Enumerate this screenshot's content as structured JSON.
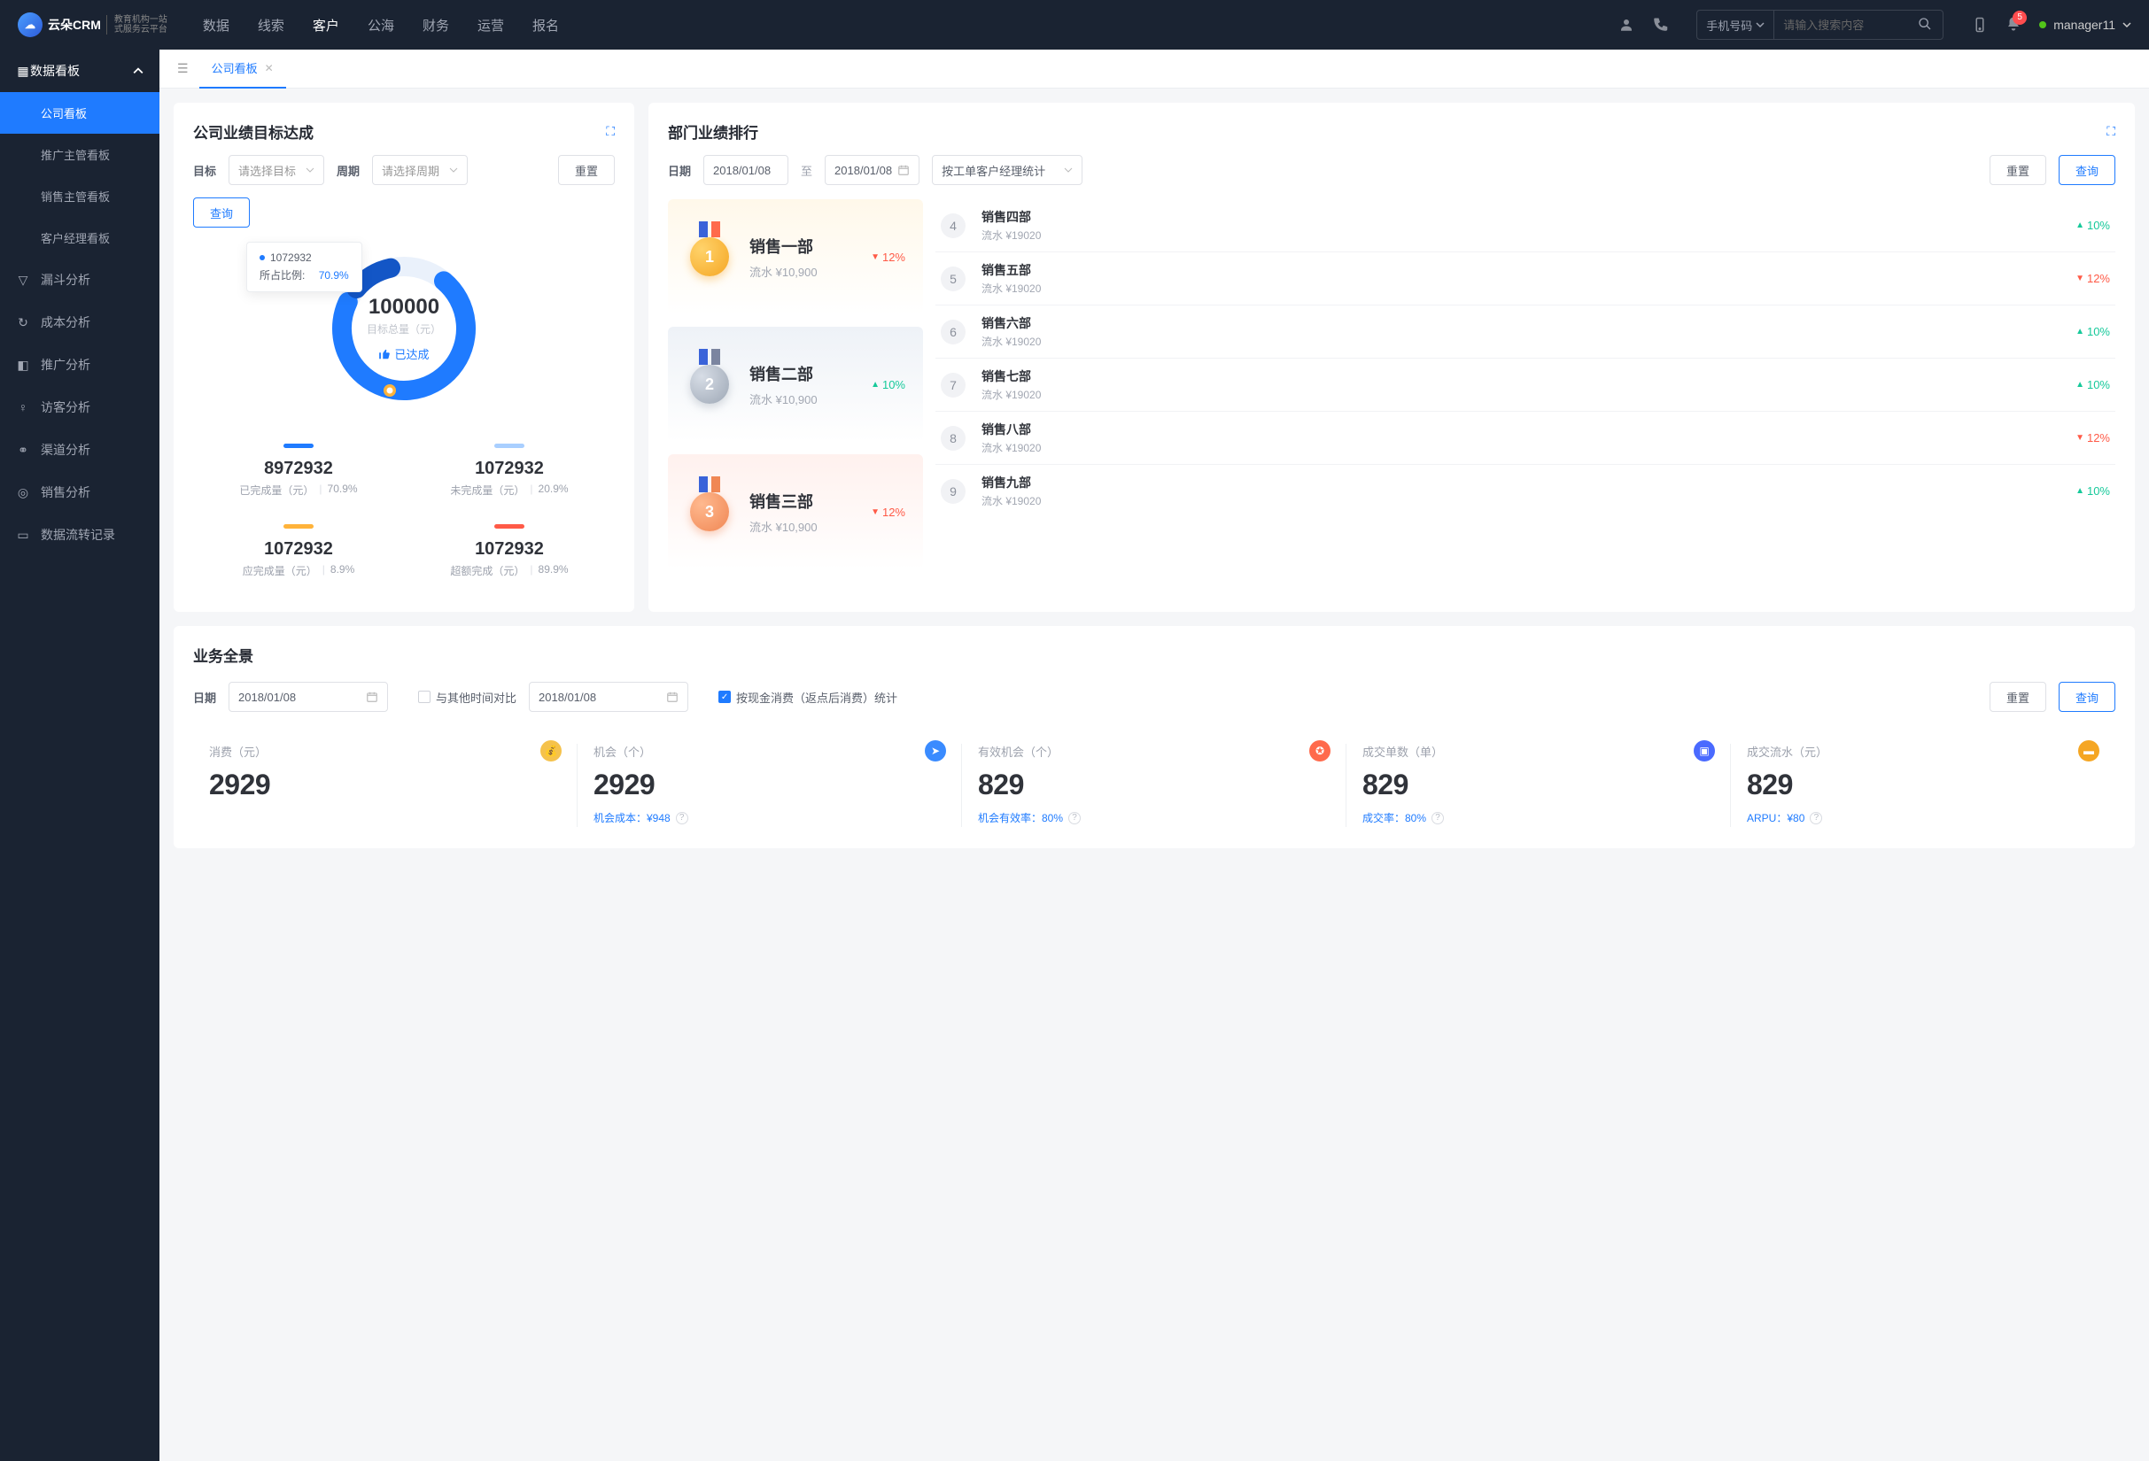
{
  "top": {
    "logo_text": "云朵CRM",
    "logo_sub": "教育机构一站\n式服务云平台",
    "nav": [
      "数据",
      "线索",
      "客户",
      "公海",
      "财务",
      "运营",
      "报名"
    ],
    "nav_active_index": 2,
    "search_type": "手机号码",
    "search_placeholder": "请输入搜索内容",
    "badge": "5",
    "user": "manager11"
  },
  "sidebar": {
    "group": "数据看板",
    "subs": [
      "公司看板",
      "推广主管看板",
      "销售主管看板",
      "客户经理看板"
    ],
    "sub_active": 0,
    "items": [
      "漏斗分析",
      "成本分析",
      "推广分析",
      "访客分析",
      "渠道分析",
      "销售分析",
      "数据流转记录"
    ]
  },
  "tabs": {
    "active": "公司看板"
  },
  "goal": {
    "title": "公司业绩目标达成",
    "label_target": "目标",
    "sel_target": "请选择目标",
    "label_period": "周期",
    "sel_period": "请选择周期",
    "btn_reset": "重置",
    "btn_query": "查询",
    "tooltip_value": "1072932",
    "tooltip_label": "所占比例:",
    "tooltip_pct": "70.9%",
    "center_value": "100000",
    "center_label": "目标总量（元）",
    "center_status": "已达成",
    "metrics": [
      {
        "bar": "m-blue",
        "v": "8972932",
        "l": "已完成量（元）",
        "p": "70.9%"
      },
      {
        "bar": "m-lblue",
        "v": "1072932",
        "l": "未完成量（元）",
        "p": "20.9%"
      },
      {
        "bar": "m-orange",
        "v": "1072932",
        "l": "应完成量（元）",
        "p": "8.9%"
      },
      {
        "bar": "m-red",
        "v": "1072932",
        "l": "超额完成（元）",
        "p": "89.9%"
      }
    ]
  },
  "rank": {
    "title": "部门业绩排行",
    "label_date": "日期",
    "date1": "2018/01/08",
    "date_sep": "至",
    "date2": "2018/01/08",
    "sel_stat": "按工单客户经理统计",
    "btn_reset": "重置",
    "btn_query": "查询",
    "podium": [
      {
        "rank": "1",
        "name": "销售一部",
        "sub": "流水 ¥10,900",
        "chg": "12%",
        "dir": "down"
      },
      {
        "rank": "2",
        "name": "销售二部",
        "sub": "流水 ¥10,900",
        "chg": "10%",
        "dir": "up"
      },
      {
        "rank": "3",
        "name": "销售三部",
        "sub": "流水 ¥10,900",
        "chg": "12%",
        "dir": "down"
      }
    ],
    "list": [
      {
        "no": "4",
        "name": "销售四部",
        "sub": "流水 ¥19020",
        "chg": "10%",
        "dir": "up"
      },
      {
        "no": "5",
        "name": "销售五部",
        "sub": "流水 ¥19020",
        "chg": "12%",
        "dir": "down"
      },
      {
        "no": "6",
        "name": "销售六部",
        "sub": "流水 ¥19020",
        "chg": "10%",
        "dir": "up"
      },
      {
        "no": "7",
        "name": "销售七部",
        "sub": "流水 ¥19020",
        "chg": "10%",
        "dir": "up"
      },
      {
        "no": "8",
        "name": "销售八部",
        "sub": "流水 ¥19020",
        "chg": "12%",
        "dir": "down"
      },
      {
        "no": "9",
        "name": "销售九部",
        "sub": "流水 ¥19020",
        "chg": "10%",
        "dir": "up"
      }
    ]
  },
  "overview": {
    "title": "业务全景",
    "label_date": "日期",
    "date1": "2018/01/08",
    "compare_label": "与其他时间对比",
    "date2": "2018/01/08",
    "stat_label": "按现金消费（返点后消费）统计",
    "btn_reset": "重置",
    "btn_query": "查询",
    "kpis": [
      {
        "label": "消费（元）",
        "v": "2929",
        "sub": ""
      },
      {
        "label": "机会（个）",
        "v": "2929",
        "sub": "机会成本：¥948"
      },
      {
        "label": "有效机会（个）",
        "v": "829",
        "sub": "机会有效率：80%"
      },
      {
        "label": "成交单数（单）",
        "v": "829",
        "sub": "成交率：80%"
      },
      {
        "label": "成交流水（元）",
        "v": "829",
        "sub": "ARPU：¥80"
      }
    ]
  },
  "chart_data": {
    "type": "pie",
    "title": "目标达成",
    "total_label": "目标总量（元）",
    "total": 100000,
    "series": [
      {
        "name": "已完成量",
        "value": 8972932,
        "pct": 70.9,
        "color": "#1f7bff"
      },
      {
        "name": "未完成量",
        "value": 1072932,
        "pct": 20.9,
        "color": "#a9cfff"
      },
      {
        "name": "应完成量",
        "value": 1072932,
        "pct": 8.9,
        "color": "#ffb33a"
      },
      {
        "name": "超额完成",
        "value": 1072932,
        "pct": 89.9,
        "color": "#ff5a47"
      }
    ]
  }
}
